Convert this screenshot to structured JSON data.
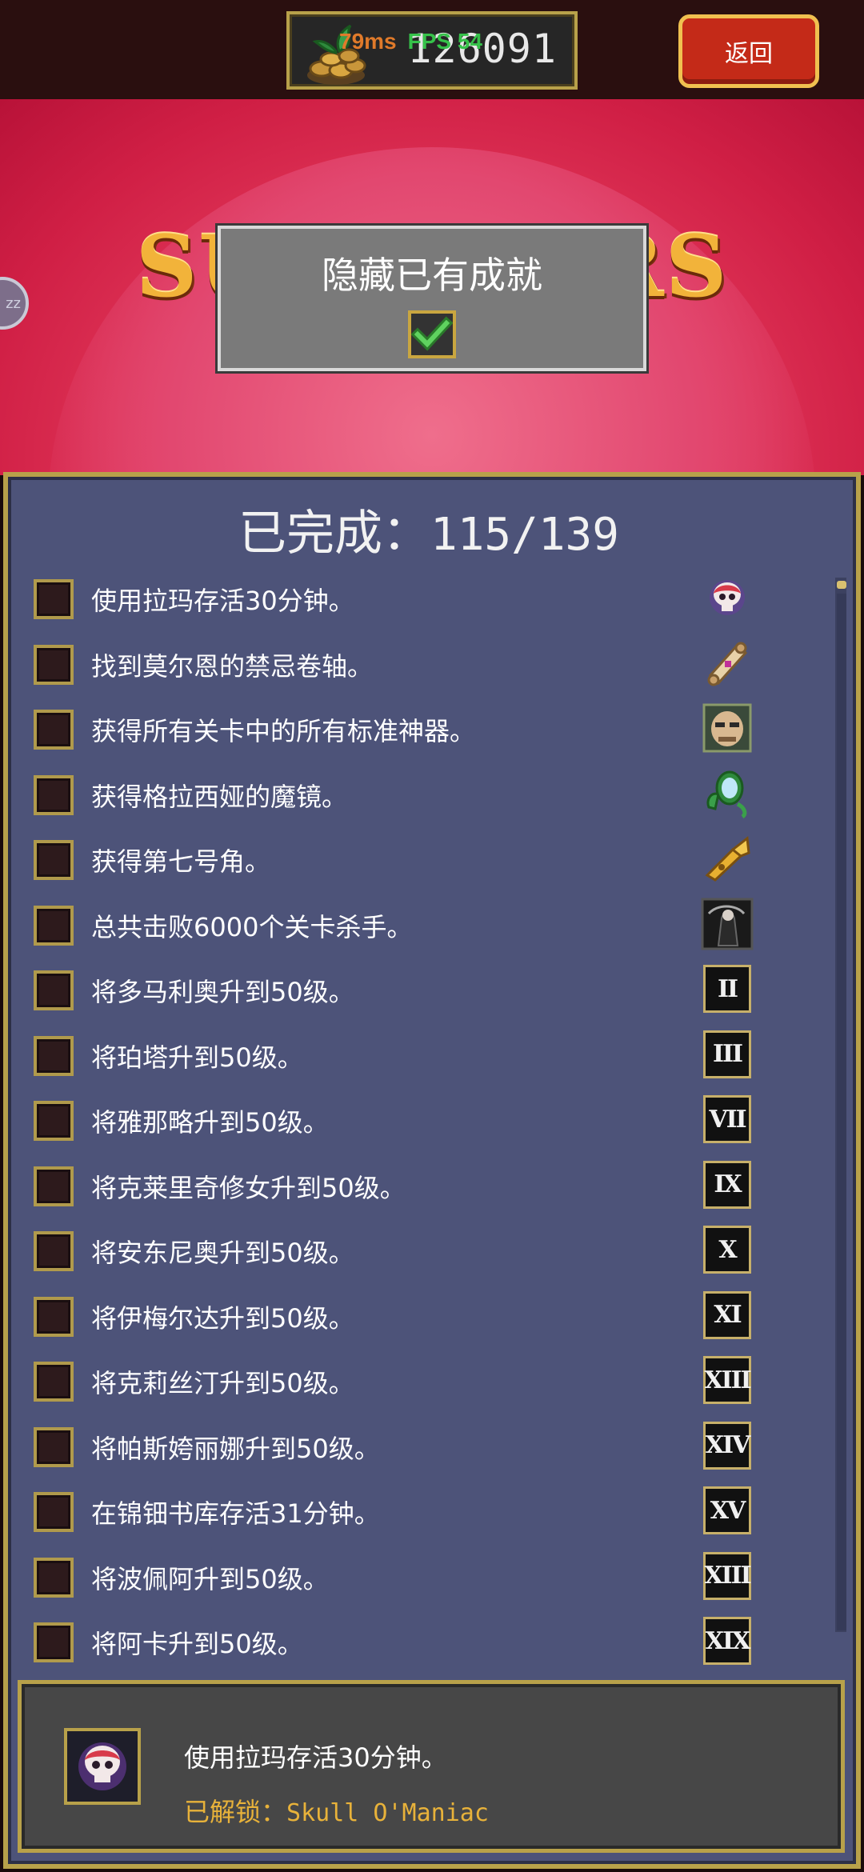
{
  "topbar": {
    "coins": "126091",
    "ping": "79ms",
    "fps": "FPS 54",
    "back_label": "返回"
  },
  "banner": {
    "logo_text": "SURVIVORS",
    "side_badge": "zz"
  },
  "hide_panel": {
    "title": "隐藏已有成就",
    "checked": true
  },
  "progress": {
    "label": "已完成：",
    "count": "115/139"
  },
  "achievements": [
    {
      "text": "使用拉玛存活30分钟。",
      "icon": "skull-icon"
    },
    {
      "text": "找到莫尔恩的禁忌卷轴。",
      "icon": "scroll-icon"
    },
    {
      "text": "获得所有关卡中的所有标准神器。",
      "icon": "mask-face-icon"
    },
    {
      "text": "获得格拉西娅的魔镜。",
      "icon": "mirror-icon"
    },
    {
      "text": "获得第七号角。",
      "icon": "trumpet-icon"
    },
    {
      "text": "总共击败6000个关卡杀手。",
      "icon": "reaper-icon"
    },
    {
      "text": "将多马利奥升到50级。",
      "icon": "roman-numeral-icon",
      "numeral": "II"
    },
    {
      "text": "将珀塔升到50级。",
      "icon": "roman-numeral-icon",
      "numeral": "III"
    },
    {
      "text": "将雅那略升到50级。",
      "icon": "roman-numeral-icon",
      "numeral": "VII"
    },
    {
      "text": "将克莱里奇修女升到50级。",
      "icon": "roman-numeral-icon",
      "numeral": "IX"
    },
    {
      "text": "将安东尼奥升到50级。",
      "icon": "roman-numeral-icon",
      "numeral": "X"
    },
    {
      "text": "将伊梅尔达升到50级。",
      "icon": "roman-numeral-icon",
      "numeral": "XI"
    },
    {
      "text": "将克莉丝汀升到50级。",
      "icon": "roman-numeral-icon",
      "numeral": "XIII"
    },
    {
      "text": "将帕斯姱丽娜升到50级。",
      "icon": "roman-numeral-icon",
      "numeral": "XIV"
    },
    {
      "text": "在锦钿书库存活31分钟。",
      "icon": "roman-numeral-icon",
      "numeral": "XV"
    },
    {
      "text": "将波佩阿升到50级。",
      "icon": "roman-numeral-icon",
      "numeral": "XIII"
    },
    {
      "text": "将阿卡升到50级。",
      "icon": "roman-numeral-icon",
      "numeral": "XIX"
    }
  ],
  "detail": {
    "description": "使用拉玛存活30分钟。",
    "unlock_label": "已解锁：",
    "unlock_name": "Skull O'Maniac",
    "icon": "skull-icon"
  }
}
